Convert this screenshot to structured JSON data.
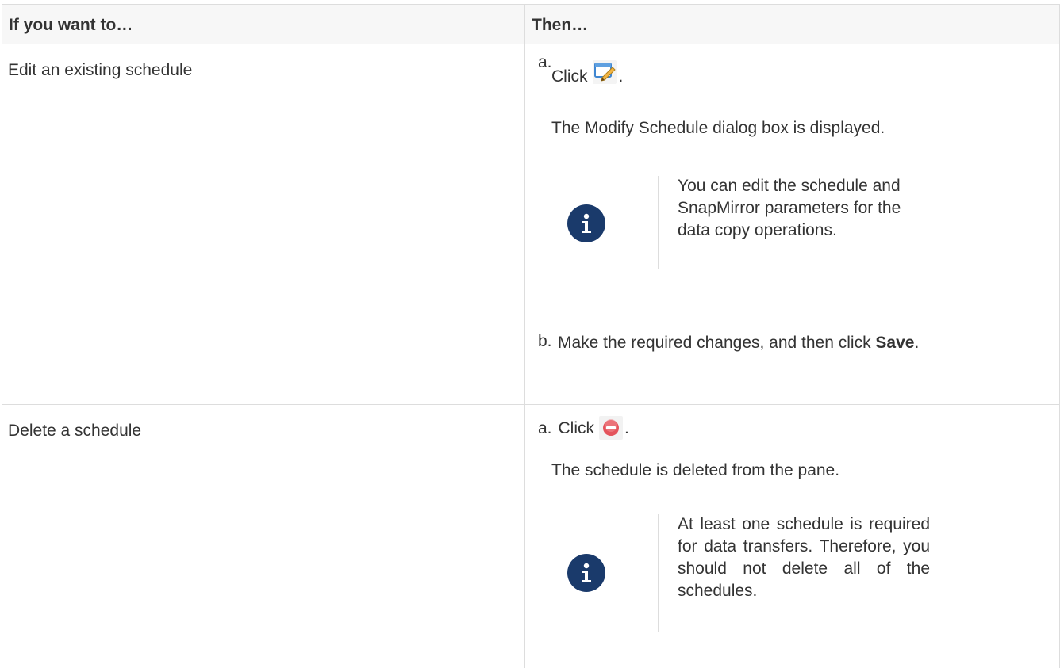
{
  "table": {
    "header": {
      "col1": "If you want to…",
      "col2": "Then…"
    },
    "rows": [
      {
        "action": "Edit an existing schedule",
        "step_a_marker": "a.",
        "step_a_click": "Click",
        "step_a_period": ".",
        "step_a_icon": "edit-pencil-icon",
        "result": "The Modify Schedule dialog box is displayed.",
        "note_icon": "info-icon",
        "note": "You can edit the schedule and SnapMirror parameters for the data copy operations.",
        "step_b_marker": "b.",
        "step_b_text": "Make the required changes, and then click",
        "step_b_bold": "Save",
        "step_b_period": "."
      },
      {
        "action": "Delete a schedule",
        "step_a_marker": "a.",
        "step_a_click": "Click",
        "step_a_period": ".",
        "step_a_icon": "delete-minus-icon",
        "result": "The schedule is deleted from the pane.",
        "note_icon": "info-icon",
        "note": "At least one schedule is required for data transfers. Therefore, you should not delete all of the schedules."
      }
    ]
  },
  "colors": {
    "info_circle": "#1a3a6b",
    "delete_red": "#e4545c",
    "edit_blue": "#3f86d1"
  }
}
